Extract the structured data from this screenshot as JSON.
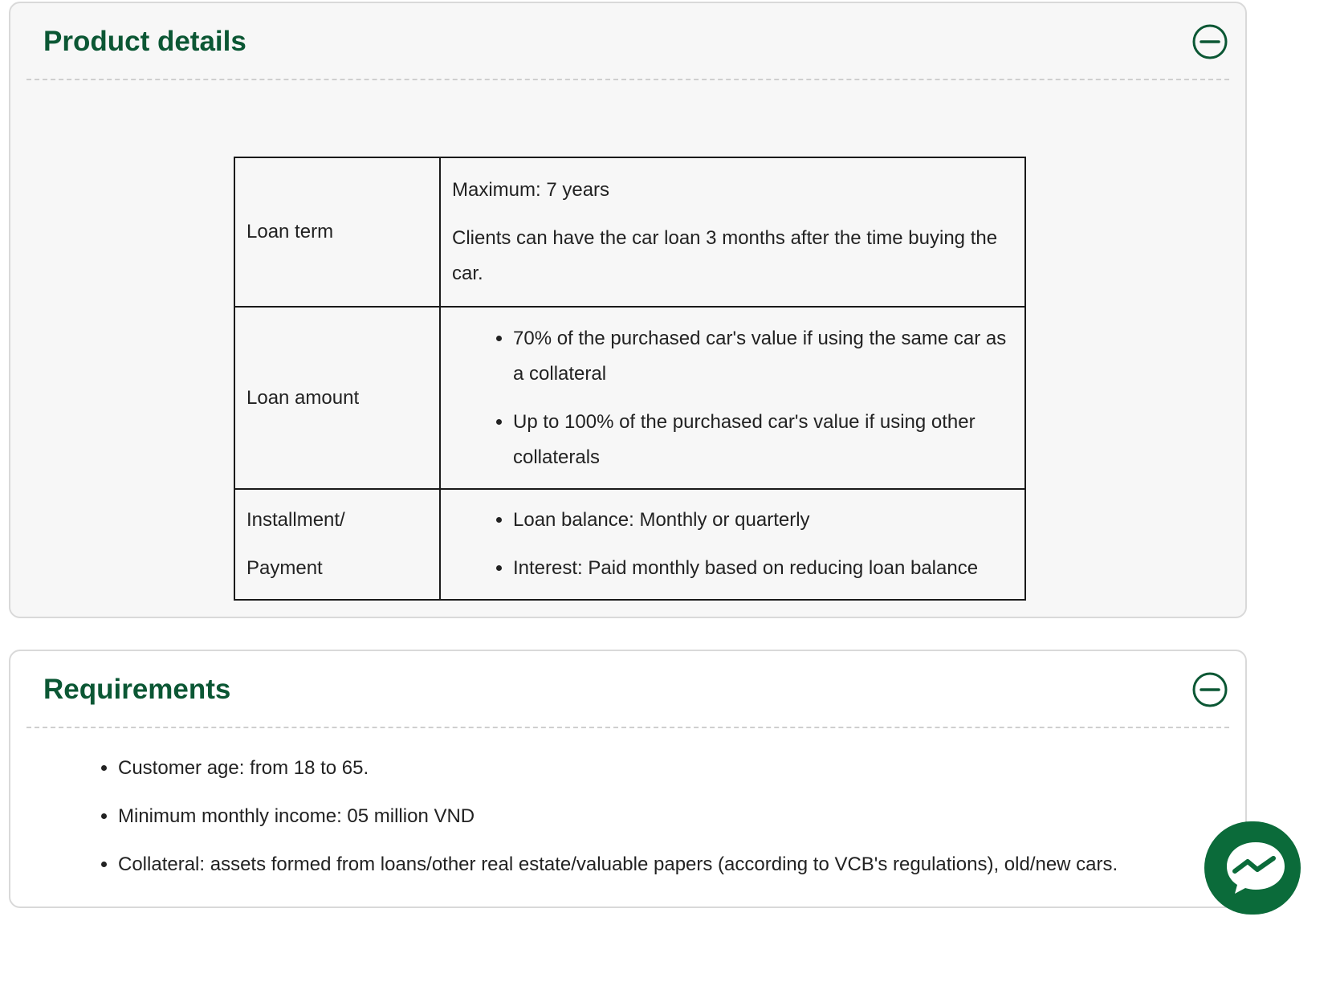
{
  "product_details": {
    "title": "Product details",
    "toggle_icon": "minus-circle-icon",
    "rows": [
      {
        "label": "Loan term",
        "paragraphs": [
          "Maximum: 7 years",
          "Clients can have the car loan 3 months after the time buying the car."
        ]
      },
      {
        "label": "Loan amount",
        "bullets": [
          "70% of the purchased car's value if using the same car as a collateral",
          "Up to 100% of the purchased car's value if using other collaterals"
        ]
      },
      {
        "label_lines": [
          "Installment/",
          "Payment"
        ],
        "bullets": [
          "Loan balance: Monthly or quarterly",
          "Interest: Paid monthly based on reducing loan balance"
        ]
      }
    ]
  },
  "requirements": {
    "title": "Requirements",
    "toggle_icon": "minus-circle-icon",
    "items": [
      "Customer age: from 18 to 65.",
      "Minimum monthly income: 05 million VND",
      "Collateral: assets formed from loans/other real estate/valuable papers (according to VCB's regulations), old/new cars."
    ]
  },
  "chat": {
    "icon": "chat-bubble-icon"
  },
  "colors": {
    "heading": "#0b5734",
    "chat_bg": "#0b6b3a",
    "panel_bg": "#f7f7f7",
    "border": "#d9d9d9"
  }
}
